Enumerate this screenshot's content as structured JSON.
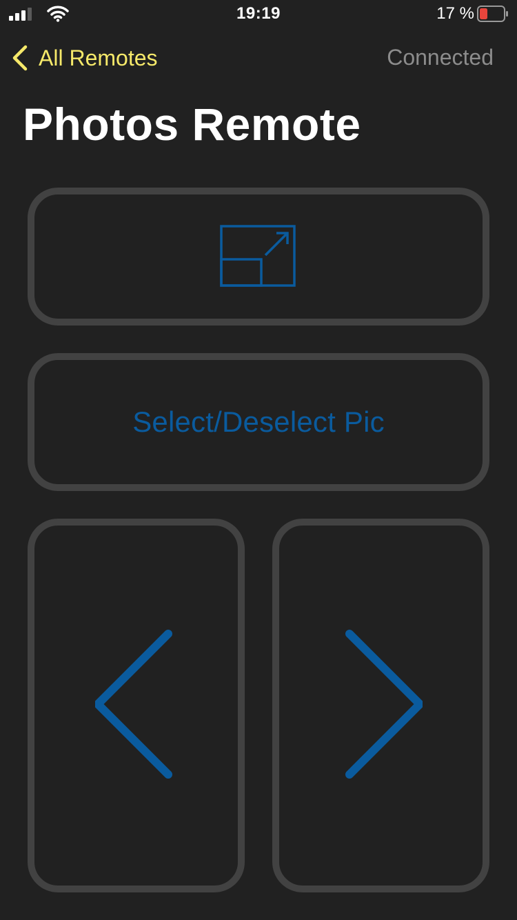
{
  "status_bar": {
    "time": "19:19",
    "battery_percent": "17 %",
    "battery_level": 0.17,
    "battery_color": "#e8453c"
  },
  "nav": {
    "back_label": "All Remotes",
    "connection_status": "Connected"
  },
  "title": "Photos Remote",
  "buttons": {
    "fullscreen_icon": "fullscreen-toggle-icon",
    "select_label": "Select/Deselect Pic",
    "prev_icon": "chevron-left-icon",
    "next_icon": "chevron-right-icon"
  },
  "colors": {
    "background": "#212121",
    "accent_blue": "#0a5b9e",
    "back_yellow": "#f6e96a",
    "button_border": "#424242",
    "status_gray": "#8c8c8c"
  }
}
